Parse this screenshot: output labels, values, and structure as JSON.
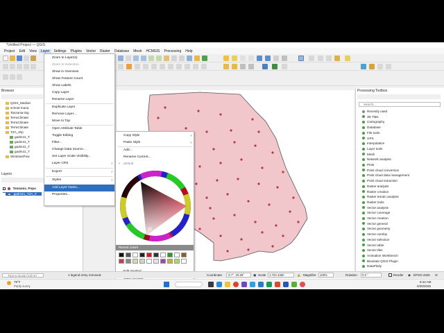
{
  "window": {
    "title": "*Untitled Project — QGIS"
  },
  "menubar": [
    "Project",
    "Edit",
    "View",
    "Layer",
    "Settings",
    "Plugins",
    "Vector",
    "Raster",
    "Database",
    "Mesh",
    "HCMGIS",
    "Processing",
    "Help"
  ],
  "browser": {
    "title": "Browser",
    "items": [
      "QGIS_Median",
      "school-mana",
      "Tanzania-Sig",
      "TerraClimate",
      "TerraClimate",
      "TerraClimate",
      "TZA_shp",
      "gadm41_T",
      "gadm41_T",
      "gadm41_T",
      "gadm41_T",
      "WindowsPow"
    ]
  },
  "layers": {
    "title": "Layers",
    "items": [
      "Tanzania_Popu",
      "gadm41_TZA_0"
    ]
  },
  "layer_menu": {
    "items": [
      "Zoom to Layer(s)",
      "Zoom to Selection",
      "Show in Overview",
      "Show Feature Count",
      "Show Labels",
      "Copy Layer",
      "Rename Layer",
      "Duplicate Layer",
      "Remove Layer...",
      "Move to Top",
      "Open Attribute Table",
      "Toggle Editing",
      "Filter...",
      "Change Data Source...",
      "Set Layer Scale Visibility...",
      "Layer CRS",
      "Export",
      "Styles",
      "Add Layer Notes...",
      "Properties..."
    ]
  },
  "style_menu": {
    "items": [
      "Copy Style",
      "Paste Style",
      "Add...",
      "Rename Current...",
      "default"
    ],
    "recent_colors": "Recent colors",
    "bottom_items": [
      "Edit Symbol...",
      "Copy Symbol",
      "Paste Symbol"
    ]
  },
  "toolbox": {
    "title": "Processing Toolbox",
    "search_placeholder": "Search...",
    "items": [
      "Recently used",
      "3D Tiles",
      "Cartography",
      "Database",
      "File tools",
      "GPS",
      "Interpolation",
      "Layer tools",
      "Mesh",
      "Network analysis",
      "Plots",
      "Point cloud conversion",
      "Point cloud data management",
      "Point cloud extraction",
      "Raster analysis",
      "Raster creation",
      "Raster terrain analysis",
      "Raster tools",
      "Vector analysis",
      "Vector coverage",
      "Vector creation",
      "Vector general",
      "Vector geometry",
      "Vector overlay",
      "Vector selection",
      "Vector table",
      "Vector tiles",
      "Animation Workbench",
      "Bivariate QGIS Plugin",
      "DataPlotly"
    ]
  },
  "statusbar": {
    "locate_placeholder": "Type to locate (Ctrl+K)",
    "message": "1 legend entry removed.",
    "coordinate_label": "Coordinate",
    "coordinate_value": "-0.7°, 20.59°",
    "scale_label": "Scale",
    "scale_value": "1:704 4350",
    "magnifier_label": "Magnifier",
    "magnifier_value": "100%",
    "rotation_label": "Rotation",
    "rotation_value": "0.0 °",
    "render_label": "Render",
    "crs": "EPSG:4326"
  },
  "taskbar": {
    "weather_temp": "79°F",
    "weather_desc": "Partly sunny",
    "time": "9:44 AM",
    "date": "6/30/2025"
  },
  "colors": {
    "map_fill": "#f2c7cb",
    "map_stroke": "#555555",
    "point": "#b03a4a",
    "highlight": "#2f6fbf"
  }
}
